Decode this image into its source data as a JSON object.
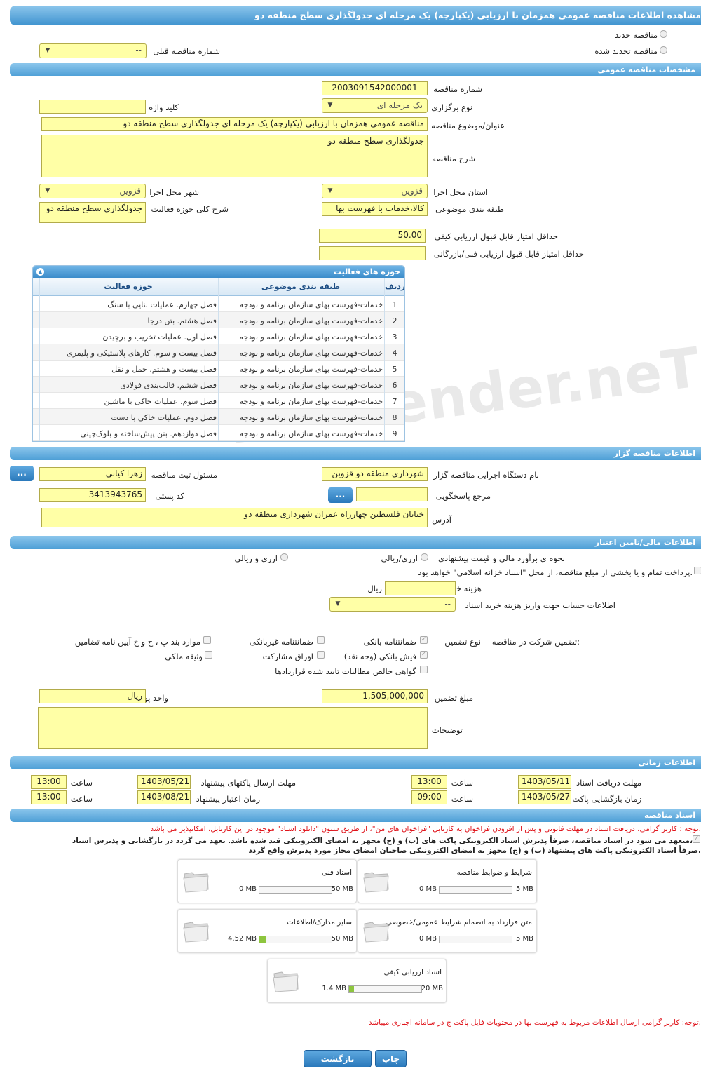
{
  "title": "مشاهده اطلاعات مناقصه عمومی همزمان با ارزیابی (یکپارچه) یک مرحله ای جدولگذاری سطح منطقه دو",
  "watermark": "AriaTender.neT",
  "tender_type": {
    "new": "مناقصه جدید",
    "renewed": "مناقصه تجدید شده",
    "prev_label": "شماره مناقصه قبلی",
    "prev_value": "--"
  },
  "general": {
    "header": "مشخصات مناقصه عمومی",
    "number_label": "شماره مناقصه",
    "number": "2003091542000001",
    "kind_label": "نوع برگزاری",
    "kind": "یک مرحله ای",
    "keyword_label": "کلید واژه",
    "keyword": "",
    "subject_label": "عنوان/موضوع مناقصه",
    "subject": "مناقصه عمومی همزمان با ارزیابی (یکپارچه) یک مرحله ای جدولگذاری سطح منطقه دو",
    "desc_label": "شرح مناقصه",
    "desc": "جدولگذاری سطح منطقه دو",
    "province_label": "استان محل اجرا",
    "province": "قزوین",
    "city_label": "شهر محل اجرا",
    "city": "قزوین",
    "category_label": "طبقه بندی موضوعی",
    "category": "کالا،خدمات با فهرست بها",
    "scope_label": "شرح کلی حوزه فعالیت",
    "scope": "جدولگذاری سطح منطقه دو",
    "min_quality_label": "حداقل امتیاز قابل قبول ارزیابی کیفی",
    "min_quality": "50.00",
    "min_tech_label": "حداقل امتیاز قابل قبول ارزیابی فنی/بازرگانی",
    "min_tech": ""
  },
  "activity": {
    "header": "حوزه های فعالیت",
    "columns": [
      "ردیف",
      "طبقه بندی موضوعی",
      "حوزه فعالیت"
    ],
    "rows": [
      [
        "1",
        "خدمات-فهرست بهای سازمان برنامه و بودجه",
        "فصل چهارم. عملیات بنایی با سنگ"
      ],
      [
        "2",
        "خدمات-فهرست بهای سازمان برنامه و بودجه",
        "فصل هشتم. بتن درجا"
      ],
      [
        "3",
        "خدمات-فهرست بهای سازمان برنامه و بودجه",
        "فصل اول. عملیات تخریب و برچیدن"
      ],
      [
        "4",
        "خدمات-فهرست بهای سازمان برنامه و بودجه",
        "فصل بیست و سوم. کارهای پلاستیکی و پلیمری"
      ],
      [
        "5",
        "خدمات-فهرست بهای سازمان برنامه و بودجه",
        "فصل بیست و هشتم. حمل و نقل"
      ],
      [
        "6",
        "خدمات-فهرست بهای سازمان برنامه و بودجه",
        "فصل ششم. قالب‌بندی فولادی"
      ],
      [
        "7",
        "خدمات-فهرست بهای سازمان برنامه و بودجه",
        "فصل سوم. عملیات خاکی با ماشین"
      ],
      [
        "8",
        "خدمات-فهرست بهای سازمان برنامه و بودجه",
        "فصل دوم. عملیات خاکی با دست"
      ],
      [
        "9",
        "خدمات-فهرست بهای سازمان برنامه و بودجه",
        "فصل دوازدهم. بتن پیش‌ساخته و بلوک‌چینی"
      ]
    ]
  },
  "organizer": {
    "header": "اطلاعات مناقصه گزار",
    "org_label": "نام دستگاه اجرایی مناقصه گزار",
    "org": "شهرداری منطقه دو قزوین",
    "resp_label": "مسئول ثبت مناقصه",
    "resp": "زهرا کیانی",
    "ref_label": "مرجع پاسخگویی",
    "ref": "",
    "postal_label": "کد پستی",
    "postal": "3413943765",
    "address_label": "آدرس",
    "address": "خیابان فلسطین چهارراه عمران شهرداری منطقه دو",
    "dots": "..."
  },
  "finance": {
    "header": "اطلاعات مالی/تامین اعتبار",
    "estimate_label": "نحوه ی برآورد مالی و قیمت پیشنهادی",
    "opt1": "ارزی/ریالی",
    "opt2": "ارزی و ریالی",
    "islamic": "پرداخت تمام و یا بخشی از مبلغ مناقصه، از محل \"اسناد خزانه اسلامی\" خواهد بود.",
    "doc_cost_label": "هزینه خرید اسناد",
    "doc_cost": "",
    "rial": "ریال",
    "account_label": "اطلاعات حساب جهت واریز هزینه خرید اسناد",
    "account": "--"
  },
  "guarantee": {
    "title": "تضمین شرکت در مناقصه:",
    "type_label": "نوع تضمین",
    "bank_guarantee": "ضمانتنامه بانکی",
    "non_bank": "ضمانتنامه غیربانکی",
    "article": "موارد بند پ ، ج و خ آیین نامه تضامین",
    "bank_check": "فیش بانکی (وجه نقد)",
    "bonds": "اوراق مشارکت",
    "property": "وثیقه ملکی",
    "receivables": "گواهی خالص مطالبات تایید شده قراردادها",
    "amount_label": "مبلغ تضمین",
    "amount": "1,505,000,000",
    "currency_label": "واحد پول",
    "currency": "ریال",
    "notes_label": "توضیحات",
    "notes": ""
  },
  "timing": {
    "header": "اطلاعات زمانی",
    "recv_label": "مهلت دریافت اسناد",
    "recv_date": "1403/05/11",
    "recv_time": "13:00",
    "send_label": "مهلت ارسال پاکتهای پیشنهاد",
    "send_date": "1403/05/21",
    "send_time": "13:00",
    "open_label": "زمان بازگشایی پاکت ها",
    "open_date": "1403/05/27",
    "open_time": "09:00",
    "valid_label": "زمان اعتبار پیشنهاد",
    "valid_date": "1403/08/21",
    "valid_time": "13:00",
    "time_label": "ساعت"
  },
  "docs": {
    "header": "اسناد مناقصه",
    "note1": "توجه : کاربر گرامی، دریافت اسناد در مهلت قانونی و پس از افزودن فراخوان به کارتابل \"فراخوان های من\"، از طریق ستون \"دانلود اسناد\" موجود در این کارتابل، امکانپذیر می باشد.",
    "commit1": "متعهد می شود در اسناد مناقصه، صرفاً پذیرش اسناد الکترونیکی پاکت های (ب) و (ج) مجهز به امضای الکترونیکی قید شده باشد. تعهد می گردد در بازگشایی و پذیرش اسناد،",
    "commit2": "صرفاً اسناد الکترونیکی پاکت های پیشنهاد (ب) و (ج) مجهز به امضای الکترونیکی صاحبان امضای مجاز مورد پذیرش واقع گردد.",
    "files": [
      {
        "name": "شرایط و ضوابط مناقصه",
        "max": "5 MB",
        "cur": "0 MB",
        "fill": 0
      },
      {
        "name": "اسناد فنی",
        "max": "50 MB",
        "cur": "0 MB",
        "fill": 0
      },
      {
        "name": "متن قرارداد به انضمام شرایط عمومی/خصوصی",
        "max": "5 MB",
        "cur": "0 MB",
        "fill": 0
      },
      {
        "name": "سایر مدارک/اطلاعات",
        "max": "50 MB",
        "cur": "4.52 MB",
        "fill": 0.09
      },
      {
        "name": "اسناد ارزیابی کیفی",
        "max": "20 MB",
        "cur": "1.4 MB",
        "fill": 0.07
      }
    ],
    "note2": "توجه: کاربر گرامی ارسال اطلاعات مربوط به فهرست بها در محتویات فایل پاکت ج در سامانه اجباری میباشد."
  },
  "buttons": {
    "print": "چاپ",
    "back": "بازگشت"
  }
}
